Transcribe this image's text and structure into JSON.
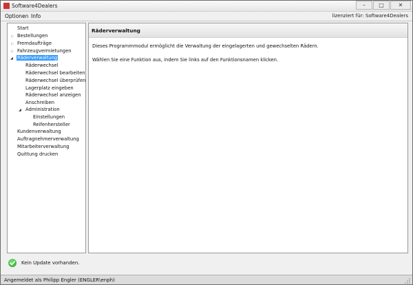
{
  "window": {
    "title": "Software4Dealers"
  },
  "menubar": {
    "items": [
      "Optionen",
      "Info"
    ],
    "license": "lizenziert für: Software4Dealers"
  },
  "nav": {
    "items": [
      "Start",
      "Bestellungen",
      "Fremdaufträge",
      "Fahrzeugvermietungen",
      "Räderverwaltung",
      "Räderwechsel",
      "Räderwechsel bearbeiten",
      "Räderwechsel überprüfen",
      "Lagerplatz eingeben",
      "Räderwechsel anzeigen",
      "Anschreiben",
      "Administration",
      "Einstellungen",
      "Reifenhersteller",
      "Kundenverwaltung",
      "Auftragnehmerverwaltung",
      "Mitarbeiterverwaltung",
      "Quittung drucken"
    ]
  },
  "content": {
    "title": "Räderverwaltung",
    "paragraphs": [
      "Dieses Programmmodul ermöglicht die Verwaltung der eingelagerten und gewechselten Rädern.",
      "Wählen Sie eine Funktion aus, indem Sie links auf den Funktionsnamen klicken."
    ]
  },
  "update": {
    "message": "Kein Update vorhanden."
  },
  "status": {
    "text": "Angemeldet als Philipp Engler (ENGLER\\enph)"
  },
  "colors": {
    "selection": "#3399ff",
    "update_ok": "#20a020"
  }
}
